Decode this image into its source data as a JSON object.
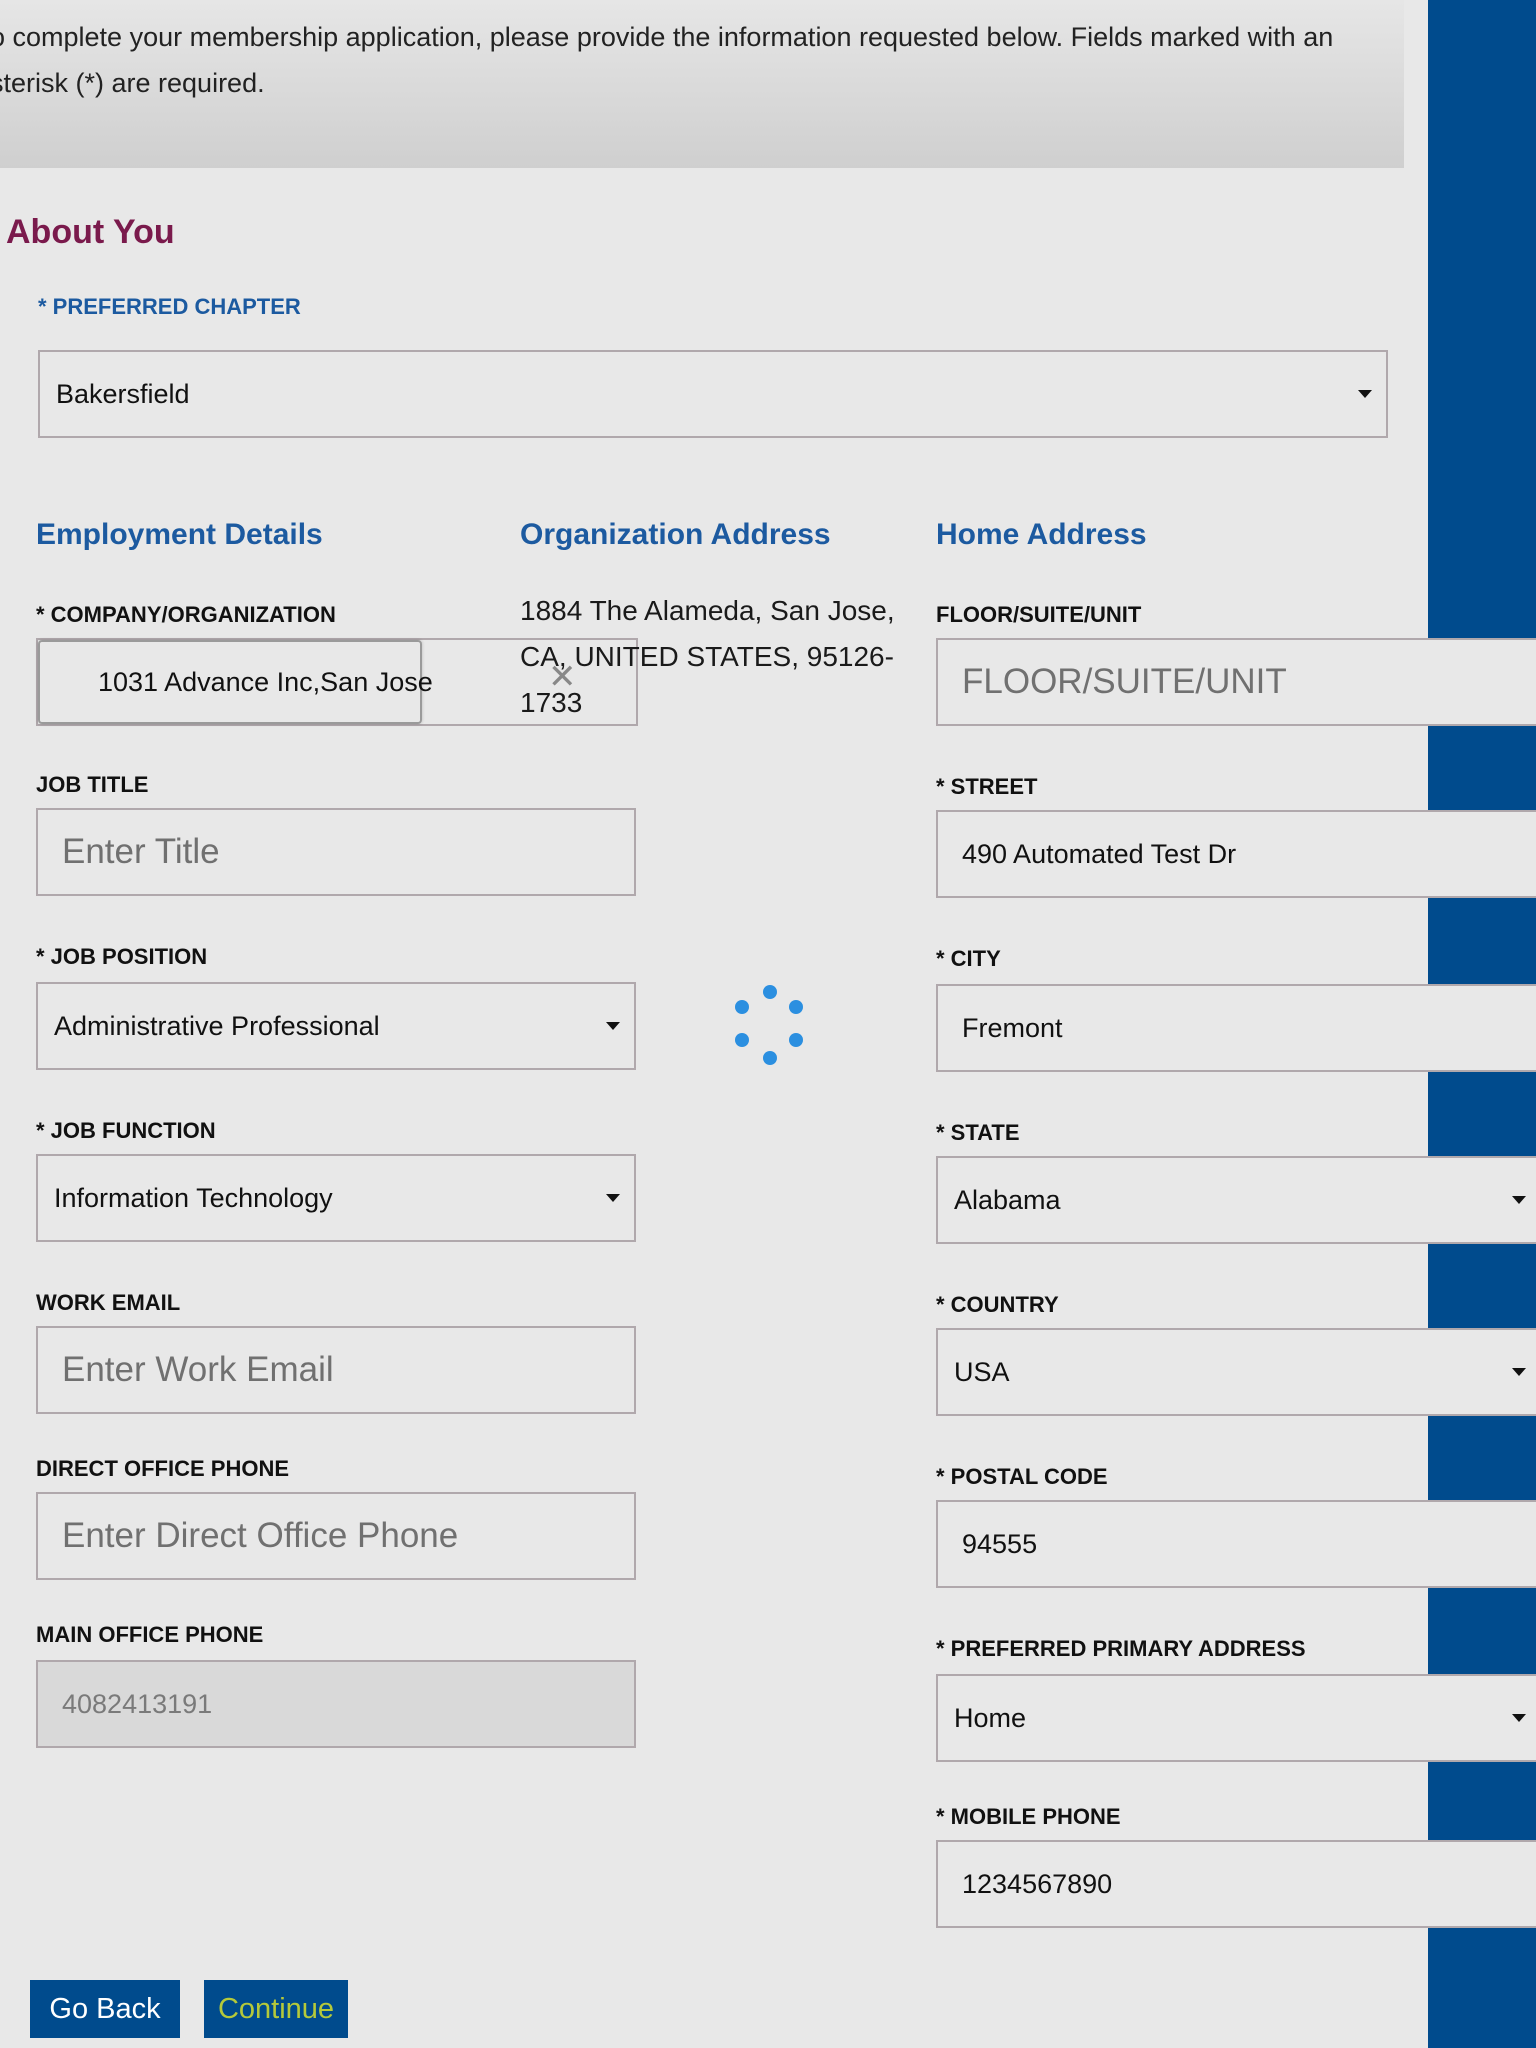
{
  "intro_text": "o complete your membership application, please provide the information requested below. Fields marked with an sterisk (*) are required.",
  "section_title": "About You",
  "preferred_chapter": {
    "label": "* PREFERRED CHAPTER",
    "value": "Bakersfield"
  },
  "employment": {
    "heading": "Employment Details",
    "company": {
      "label": "* COMPANY/ORGANIZATION",
      "value": "1031 Advance Inc,San Jose"
    },
    "job_title": {
      "label": "JOB TITLE",
      "placeholder": "Enter Title"
    },
    "job_position": {
      "label": "* JOB POSITION",
      "value": "Administrative Professional"
    },
    "job_function": {
      "label": "* JOB FUNCTION",
      "value": "Information Technology"
    },
    "work_email": {
      "label": "WORK EMAIL",
      "placeholder": "Enter Work Email"
    },
    "direct_phone": {
      "label": "DIRECT OFFICE PHONE",
      "placeholder": "Enter Direct Office Phone"
    },
    "main_phone": {
      "label": "MAIN OFFICE PHONE",
      "value": "4082413191"
    }
  },
  "organization_address": {
    "heading": "Organization Address",
    "text": "1884 The Alameda, San Jose, CA, UNITED STATES, 95126-1733"
  },
  "home": {
    "heading": "Home Address",
    "floor": {
      "label": "FLOOR/SUITE/UNIT",
      "placeholder": "FLOOR/SUITE/UNIT"
    },
    "street": {
      "label": "* STREET",
      "value": "490 Automated Test Dr"
    },
    "city": {
      "label": "* CITY",
      "value": "Fremont"
    },
    "state": {
      "label": "* STATE",
      "value": "Alabama"
    },
    "country": {
      "label": "* COUNTRY",
      "value": "USA"
    },
    "postal": {
      "label": "* POSTAL CODE",
      "value": "94555"
    },
    "primary_address": {
      "label": "* PREFERRED PRIMARY ADDRESS",
      "value": "Home"
    },
    "mobile": {
      "label": "* MOBILE PHONE",
      "value": "1234567890"
    }
  },
  "buttons": {
    "back": "Go Back",
    "continue": "Continue"
  },
  "colors": {
    "brand_blue": "#004b8d",
    "heading_blue": "#1c5aa0",
    "section_maroon": "#7a1a4c",
    "continue_text": "#b5c93a",
    "spinner": "#2b8fe0"
  },
  "icons": {
    "dropdown": "caret-down-icon",
    "clear": "close-icon",
    "loading": "spinner-icon"
  }
}
